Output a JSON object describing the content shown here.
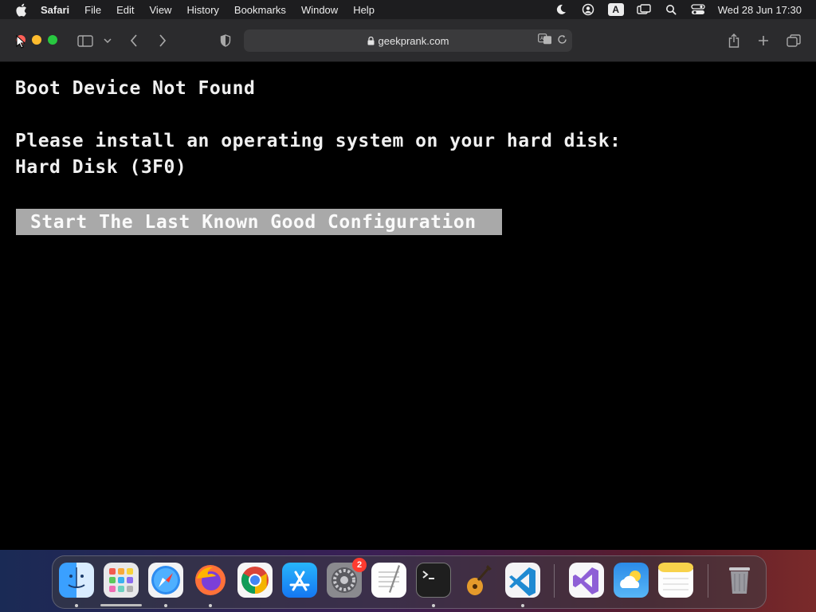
{
  "menubar": {
    "app_name": "Safari",
    "menus": [
      "File",
      "Edit",
      "View",
      "History",
      "Bookmarks",
      "Window",
      "Help"
    ],
    "status_icons": [
      "moon-icon",
      "user-account-icon",
      "input-source-icon",
      "screen-mirroring-icon",
      "spotlight-search-icon",
      "control-center-icon"
    ],
    "input_source_label": "A",
    "clock": "Wed 28 Jun  17:30"
  },
  "toolbar": {
    "url": "geekprank.com"
  },
  "page": {
    "line1": "Boot Device Not Found",
    "line2": "Please install an operating system on your hard disk:",
    "line3": "Hard Disk (3F0)",
    "button_label": "Start The Last Known Good Configuration"
  },
  "dock": {
    "apps": [
      {
        "name": "Finder",
        "icon": "finder-icon",
        "running": true
      },
      {
        "name": "Launchpad",
        "icon": "launchpad-icon",
        "running": false
      },
      {
        "name": "Safari",
        "icon": "safari-icon",
        "running": true
      },
      {
        "name": "Firefox",
        "icon": "firefox-icon",
        "running": true
      },
      {
        "name": "Google Chrome",
        "icon": "chrome-icon",
        "running": false
      },
      {
        "name": "App Store",
        "icon": "app-store-icon",
        "running": false
      },
      {
        "name": "System Settings",
        "icon": "system-settings-icon",
        "running": false,
        "badge": "2"
      },
      {
        "name": "TextEdit",
        "icon": "textedit-icon",
        "running": false
      },
      {
        "name": "Terminal",
        "icon": "terminal-icon",
        "running": true
      },
      {
        "name": "GarageBand",
        "icon": "garageband-icon",
        "running": false
      },
      {
        "name": "Visual Studio Code",
        "icon": "vscode-icon",
        "running": true
      },
      {
        "name": "Visual Studio",
        "icon": "visual-studio-icon",
        "running": false
      },
      {
        "name": "Weather",
        "icon": "weather-icon",
        "running": false
      },
      {
        "name": "Notes",
        "icon": "notes-icon",
        "running": false
      },
      {
        "name": "Trash",
        "icon": "trash-icon",
        "running": false
      }
    ]
  }
}
